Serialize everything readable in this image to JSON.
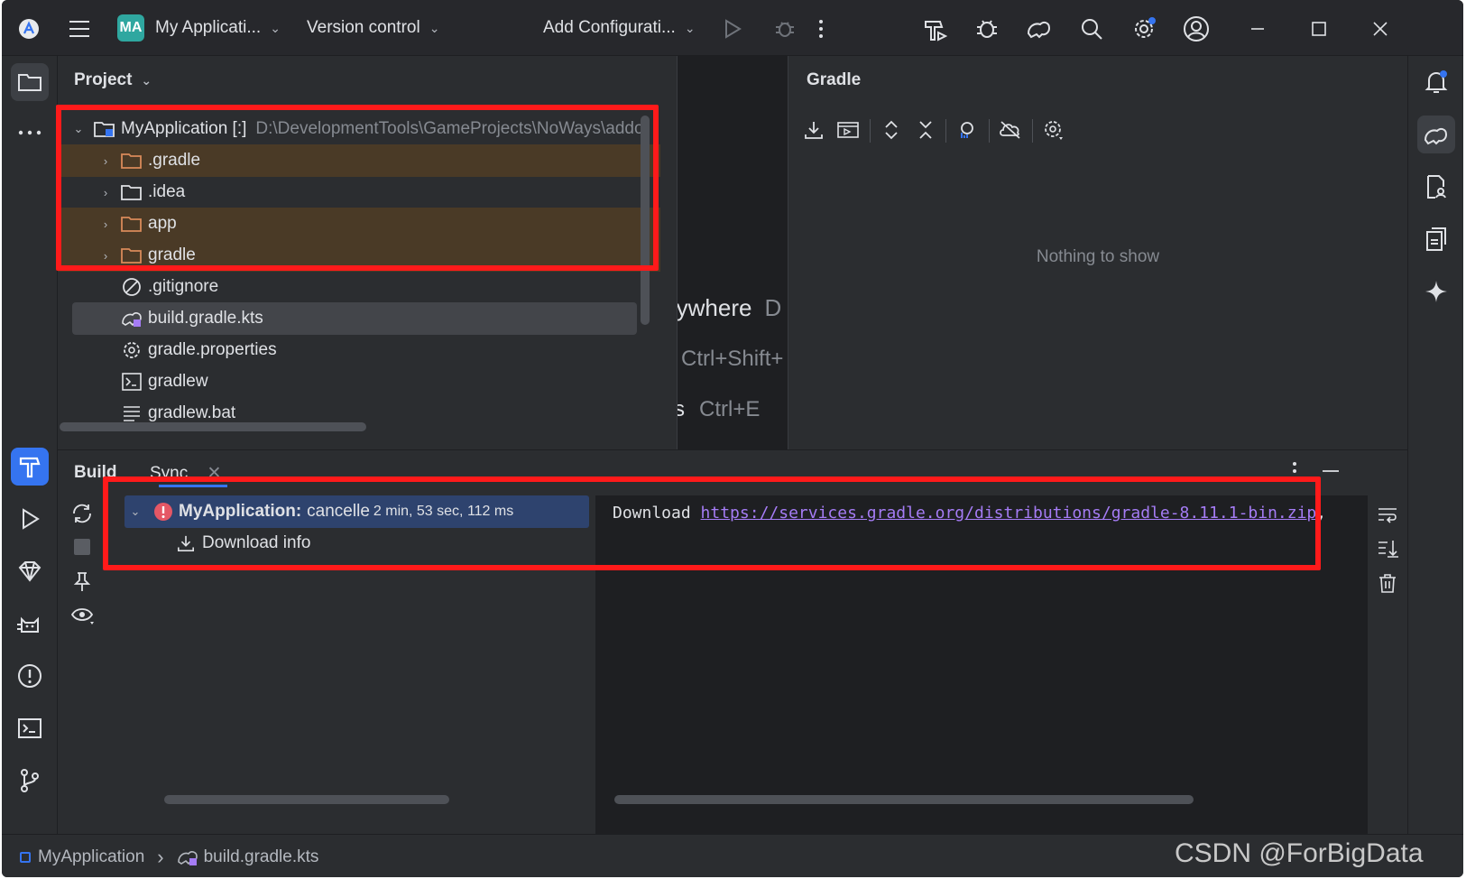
{
  "titlebar": {
    "project_badge": "MA",
    "project_name": "My Applicati...",
    "vcs": "Version control",
    "run_config": "Add Configurati..."
  },
  "project_panel": {
    "title": "Project",
    "root": {
      "name": "MyApplication [:]",
      "path": "D:\\DevelopmentTools\\GameProjects\\NoWays\\addo"
    },
    "items": [
      {
        "label": ".gradle",
        "type": "folder"
      },
      {
        "label": ".idea",
        "type": "folder"
      },
      {
        "label": "app",
        "type": "folder"
      },
      {
        "label": "gradle",
        "type": "folder"
      },
      {
        "label": ".gitignore",
        "type": "ignore-file"
      },
      {
        "label": "build.gradle.kts",
        "type": "gradle-file"
      },
      {
        "label": "gradle.properties",
        "type": "properties-file"
      },
      {
        "label": "gradlew",
        "type": "shell-file"
      },
      {
        "label": "gradlew.bat",
        "type": "text-file"
      }
    ]
  },
  "editor_hints": {
    "line1": "rywhere",
    "line1_suffix": "D",
    "line2": "Ctrl+Shift+",
    "line3_prefix": "s",
    "line3": "Ctrl+E"
  },
  "gradle_panel": {
    "title": "Gradle",
    "empty_text": "Nothing to show"
  },
  "build_panel": {
    "tab_build": "Build",
    "tab_sync": "Sync",
    "tree_root_name": "MyApplication:",
    "tree_root_status": "cancelle",
    "tree_root_time": "2 min, 53 sec, 112 ms",
    "tree_child": "Download info",
    "console_prefix": "Download ",
    "console_link": "https://services.gradle.org/distributions/gradle-8.11.1-bin.zip",
    "console_suffix": ","
  },
  "statusbar": {
    "crumb_project": "MyApplication",
    "crumb_file": "build.gradle.kts",
    "watermark": "CSDN @ForBigData"
  },
  "colors": {
    "accent": "#3574f0",
    "annotation": "#ff1a1a",
    "highlight_row": "#4a3a26",
    "error": "#e55765"
  }
}
